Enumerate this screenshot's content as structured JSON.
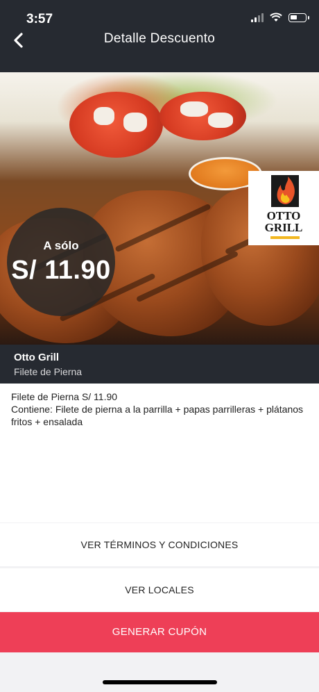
{
  "status_bar": {
    "time": "3:57",
    "battery_level": 0.5
  },
  "header": {
    "title": "Detalle Descuento"
  },
  "hero": {
    "price_label": "A sólo",
    "price_value": "S/ 11.90",
    "logo_line1": "OTTO",
    "logo_line2": "GRILL"
  },
  "info": {
    "restaurant": "Otto Grill",
    "dish": "Filete de Pierna"
  },
  "description": {
    "line1": "Filete de Pierna S/ 11.90",
    "line2": "Contiene: Filete de pierna a la parrilla + papas parrilleras + plátanos fritos + ensalada"
  },
  "actions": {
    "terms_label": "VER TÉRMINOS Y CONDICIONES",
    "locales_label": "VER LOCALES",
    "generate_label": "GENERAR CUPÓN"
  },
  "colors": {
    "header_bg": "#262a31",
    "accent": "#ee3f57"
  }
}
